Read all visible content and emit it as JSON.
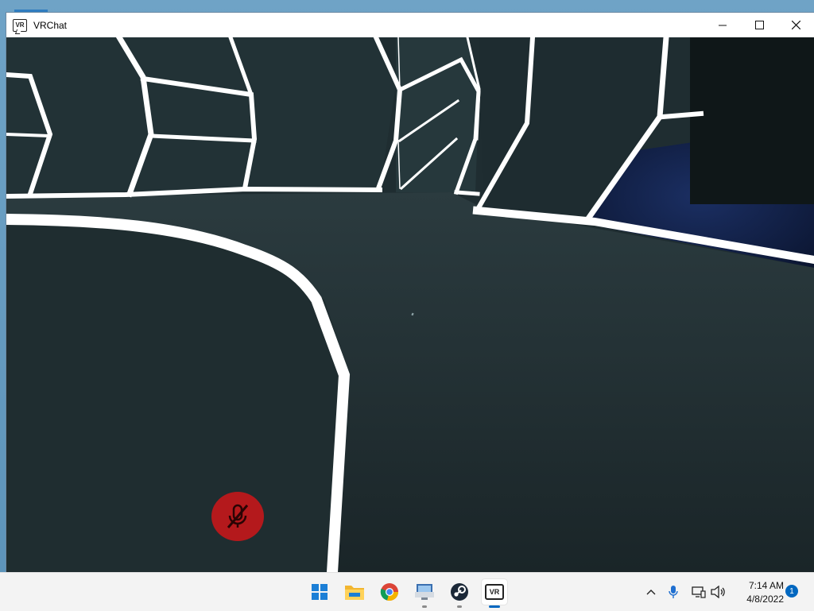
{
  "window": {
    "app_icon": "vr-icon",
    "app_icon_text": "VR",
    "title": "VRChat",
    "controls": [
      "minimize",
      "maximize",
      "close"
    ]
  },
  "game": {
    "mute_indicator": "muted-microphone-icon",
    "accent_color": "#b4191c"
  },
  "taskbar": {
    "apps": [
      {
        "name": "Start",
        "icon": "windows-logo-icon"
      },
      {
        "name": "File Explorer",
        "icon": "folder-icon"
      },
      {
        "name": "Google Chrome",
        "icon": "chrome-icon"
      },
      {
        "name": "Remote Desktop",
        "icon": "remote-desktop-icon"
      },
      {
        "name": "Steam",
        "icon": "steam-icon"
      },
      {
        "name": "VRChat",
        "icon": "vr-icon",
        "label": "VR"
      }
    ],
    "tray": {
      "icons": [
        "chevron-up-icon",
        "microphone-icon",
        "network-icon",
        "speaker-icon"
      ],
      "time": "7:14 AM",
      "date": "4/8/2022",
      "notification_count": "1"
    }
  }
}
